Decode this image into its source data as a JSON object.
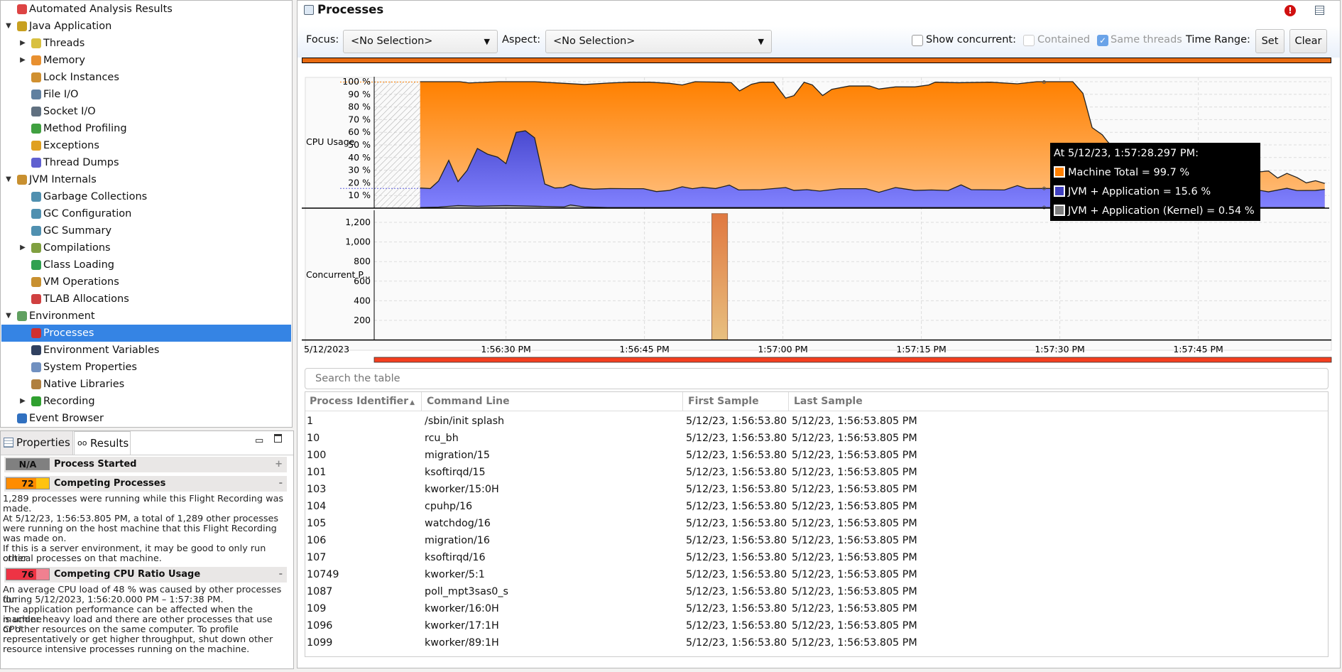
{
  "tree": {
    "items": [
      {
        "label": "Automated Analysis Results",
        "level": 0,
        "icon": "analysis-icon",
        "color": "#d44"
      },
      {
        "label": "Java Application",
        "level": 0,
        "expander": "expanded",
        "icon": "java-app-icon",
        "color": "#c8a020"
      },
      {
        "label": "Threads",
        "level": 1,
        "expander": "collapsed",
        "icon": "threads-icon",
        "color": "#d8c040"
      },
      {
        "label": "Memory",
        "level": 1,
        "expander": "collapsed",
        "icon": "memory-icon",
        "color": "#e89030"
      },
      {
        "label": "Lock Instances",
        "level": 1,
        "icon": "lock-icon",
        "color": "#d09030"
      },
      {
        "label": "File I/O",
        "level": 1,
        "icon": "file-io-icon",
        "color": "#6080a0"
      },
      {
        "label": "Socket I/O",
        "level": 1,
        "icon": "socket-io-icon",
        "color": "#607080"
      },
      {
        "label": "Method Profiling",
        "level": 1,
        "icon": "method-profiling-icon",
        "color": "#40a040"
      },
      {
        "label": "Exceptions",
        "level": 1,
        "icon": "exceptions-icon",
        "color": "#e0a020"
      },
      {
        "label": "Thread Dumps",
        "level": 1,
        "icon": "thread-dumps-icon",
        "color": "#6060d0"
      },
      {
        "label": "JVM Internals",
        "level": 0,
        "expander": "expanded",
        "icon": "jvm-internals-icon",
        "color": "#c89030"
      },
      {
        "label": "Garbage Collections",
        "level": 1,
        "icon": "trash-icon",
        "color": "#5090b0"
      },
      {
        "label": "GC Configuration",
        "level": 1,
        "icon": "gc-config-icon",
        "color": "#5090b0"
      },
      {
        "label": "GC Summary",
        "level": 1,
        "icon": "gc-summary-icon",
        "color": "#5090b0"
      },
      {
        "label": "Compilations",
        "level": 1,
        "expander": "collapsed",
        "icon": "compilations-icon",
        "color": "#80a040"
      },
      {
        "label": "Class Loading",
        "level": 1,
        "icon": "class-loading-icon",
        "color": "#30a050"
      },
      {
        "label": "VM Operations",
        "level": 1,
        "icon": "vm-operations-icon",
        "color": "#c89030"
      },
      {
        "label": "TLAB Allocations",
        "level": 1,
        "icon": "tlab-icon",
        "color": "#d04040"
      },
      {
        "label": "Environment",
        "level": 0,
        "expander": "expanded",
        "icon": "environment-icon",
        "color": "#60a060"
      },
      {
        "label": "Processes",
        "level": 1,
        "icon": "processes-icon",
        "color": "#d03030",
        "selected": true
      },
      {
        "label": "Environment Variables",
        "level": 1,
        "icon": "env-vars-icon",
        "color": "#304060"
      },
      {
        "label": "System Properties",
        "level": 1,
        "icon": "system-properties-icon",
        "color": "#7090c0"
      },
      {
        "label": "Native Libraries",
        "level": 1,
        "icon": "native-libraries-icon",
        "color": "#b08040"
      },
      {
        "label": "Recording",
        "level": 1,
        "expander": "collapsed",
        "icon": "recording-icon",
        "color": "#30a030"
      },
      {
        "label": "Event Browser",
        "level": 0,
        "icon": "event-browser-icon",
        "color": "#3070c0"
      }
    ]
  },
  "bottom_panel": {
    "tabs": [
      {
        "label": "Properties",
        "icon": "properties-icon"
      },
      {
        "label": "Results",
        "icon": "results-icon",
        "active": true
      }
    ],
    "results": [
      {
        "score": "N/A",
        "title": "Process Started",
        "toggle": "+",
        "color": "#808080",
        "color2": "#808080",
        "lines": []
      },
      {
        "score": "72",
        "title": "Competing Processes",
        "toggle": "-",
        "color": "#ff8c00",
        "color2": "#ffc30f",
        "lines": [
          "1,289 processes were running while this Flight Recording was",
          "made.",
          "At 5/12/23, 1:56:53.805 PM, a total of 1,289 other processes",
          "were running on the host machine that this Flight Recording",
          "was made on.",
          "If this is a server environment, it may be good to only run other",
          "critical processes on that machine."
        ]
      },
      {
        "score": "76",
        "title": "Competing CPU Ratio Usage",
        "toggle": "-",
        "color": "#ee3344",
        "color2": "#f08090",
        "lines": [
          "An average CPU load of 48 % was caused by other processes for",
          "during 5/12/2023, 1:56:20.000 PM – 1:57:38 PM.",
          "The application performance can be affected when the machine",
          "is under heavy load and there are other processes that use CPU",
          "or other resources on the same computer. To profile",
          "representatively or get higher throughput, shut down other",
          "resource intensive processes running on the machine."
        ]
      }
    ]
  },
  "page": {
    "title": "Processes",
    "icons": [
      "processes-icon",
      "error-icon",
      "table-menu-icon"
    ]
  },
  "toolbar": {
    "focus_label": "Focus:",
    "focus_value": "<No Selection>",
    "aspect_label": "Aspect:",
    "aspect_value": "<No Selection>",
    "show_concurrent_label": "Show concurrent:",
    "show_concurrent": false,
    "contained_label": "Contained",
    "contained": false,
    "same_threads_label": "Same threads",
    "same_threads": true,
    "time_range_label": "Time Range:",
    "set_label": "Set",
    "clear_label": "Clear",
    "accent": "#e86a10"
  },
  "chart_data": [
    {
      "type": "area",
      "ylabel": "CPU Usage",
      "yticks": [
        "10 %",
        "20 %",
        "30 %",
        "40 %",
        "50 %",
        "60 %",
        "70 %",
        "80 %",
        "90 %",
        "100 %"
      ],
      "ylim": [
        0,
        100
      ],
      "xlim": [
        "1:56:15.8",
        "1:57:59.1"
      ],
      "grid": true,
      "series": [
        {
          "name": "Machine Total",
          "color": "#ff8000",
          "points": [
            [
              "1:56:20.7",
              100
            ],
            [
              "1:56:25.0",
              100
            ],
            [
              "1:56:26.0",
              99
            ],
            [
              "1:56:29.2",
              100
            ],
            [
              "1:56:33.1",
              100
            ],
            [
              "1:56:36.3",
              98.7
            ],
            [
              "1:56:38.5",
              97.8
            ],
            [
              "1:56:41.3",
              99
            ],
            [
              "1:56:43.4",
              99.6
            ],
            [
              "1:56:45.6",
              99.6
            ],
            [
              "1:56:47.7",
              98.7
            ],
            [
              "1:56:49.1",
              97.4
            ],
            [
              "1:56:50.5",
              100
            ],
            [
              "1:56:53.4",
              99.6
            ],
            [
              "1:56:54.4",
              99.3
            ],
            [
              "1:56:55.3",
              92.7
            ],
            [
              "1:56:56.6",
              98
            ],
            [
              "1:56:57.6",
              99.6
            ],
            [
              "1:56:59.0",
              99.6
            ],
            [
              "1:57:00.3",
              87
            ],
            [
              "1:57:01.2",
              89
            ],
            [
              "1:57:02.3",
              99.6
            ],
            [
              "1:57:03.2",
              97.4
            ],
            [
              "1:57:04.3",
              89
            ],
            [
              "1:57:05.3",
              94
            ],
            [
              "1:57:07.2",
              96.6
            ],
            [
              "1:57:09.4",
              96.6
            ],
            [
              "1:57:10.4",
              94.2
            ],
            [
              "1:57:12.2",
              95.9
            ],
            [
              "1:57:14.3",
              95.9
            ],
            [
              "1:57:15.8",
              97.4
            ],
            [
              "1:57:16.5",
              99.6
            ],
            [
              "1:57:19.0",
              99.2
            ],
            [
              "1:57:22.5",
              99.6
            ],
            [
              "1:57:25.4",
              98.3
            ],
            [
              "1:57:27.5",
              100
            ],
            [
              "1:57:31.4",
              100
            ],
            [
              "1:57:32.5",
              90.8
            ],
            [
              "1:57:33.5",
              63.7
            ],
            [
              "1:57:34.6",
              58
            ],
            [
              "1:57:35.2",
              52.4
            ],
            [
              "1:57:36.5",
              42
            ],
            [
              "1:57:38.0",
              34
            ],
            [
              "1:57:40.0",
              31
            ],
            [
              "1:57:43.0",
              30
            ],
            [
              "1:57:46.0",
              29
            ],
            [
              "1:57:49.0",
              31
            ],
            [
              "1:57:51.8",
              28.8
            ],
            [
              "1:57:52.6",
              29.4
            ],
            [
              "1:57:53.6",
              23.8
            ],
            [
              "1:57:54.6",
              27.5
            ],
            [
              "1:57:55.7",
              24.2
            ],
            [
              "1:57:56.7",
              20
            ],
            [
              "1:57:57.7",
              21.7
            ],
            [
              "1:57:58.7",
              19.5
            ]
          ]
        },
        {
          "name": "JVM + Application",
          "color": "#4040c0",
          "points": [
            [
              "1:56:20.7",
              15.9
            ],
            [
              "1:56:21.8",
              15.5
            ],
            [
              "1:56:22.7",
              21.5
            ],
            [
              "1:56:23.8",
              37.8
            ],
            [
              "1:56:24.8",
              21
            ],
            [
              "1:56:25.8",
              30
            ],
            [
              "1:56:26.9",
              47.2
            ],
            [
              "1:56:28.0",
              42.7
            ],
            [
              "1:56:29.1",
              40.3
            ],
            [
              "1:56:30.0",
              35.2
            ],
            [
              "1:56:31.1",
              59.9
            ],
            [
              "1:56:32.1",
              61.2
            ],
            [
              "1:56:33.1",
              55.6
            ],
            [
              "1:56:34.2",
              19.1
            ],
            [
              "1:56:35.3",
              15.9
            ],
            [
              "1:56:36.2",
              16.3
            ],
            [
              "1:56:37.0",
              18.7
            ],
            [
              "1:56:38.1",
              15.9
            ],
            [
              "1:56:39.5",
              15
            ],
            [
              "1:56:41.3",
              15.5
            ],
            [
              "1:56:43.4",
              15.4
            ],
            [
              "1:56:44.9",
              15.4
            ],
            [
              "1:56:46.3",
              13.1
            ],
            [
              "1:56:47.7",
              14
            ],
            [
              "1:56:49.1",
              16.9
            ],
            [
              "1:56:50.2",
              15.4
            ],
            [
              "1:56:51.3",
              16.5
            ],
            [
              "1:56:52.7",
              15.5
            ],
            [
              "1:56:54.2",
              18.2
            ],
            [
              "1:56:55.2",
              14.4
            ],
            [
              "1:56:57.6",
              14.6
            ],
            [
              "1:57:00.3",
              16.3
            ],
            [
              "1:57:01.2",
              14
            ],
            [
              "1:57:02.6",
              14.6
            ],
            [
              "1:57:04.0",
              13.5
            ],
            [
              "1:57:06.2",
              15.4
            ],
            [
              "1:57:09.0",
              15.4
            ],
            [
              "1:57:10.4",
              12.5
            ],
            [
              "1:57:12.2",
              16.3
            ],
            [
              "1:57:14.3",
              14
            ],
            [
              "1:57:16.1",
              14.4
            ],
            [
              "1:57:17.9",
              13.9
            ],
            [
              "1:57:19.3",
              18.4
            ],
            [
              "1:57:20.4",
              14.6
            ],
            [
              "1:57:24.0",
              14.4
            ],
            [
              "1:57:25.4",
              17.8
            ],
            [
              "1:57:26.4",
              15.5
            ],
            [
              "1:57:28.6",
              15.6
            ],
            [
              "1:57:32.0",
              15
            ],
            [
              "1:57:36.0",
              16
            ],
            [
              "1:57:40.0",
              14.5
            ],
            [
              "1:57:44.0",
              15.5
            ],
            [
              "1:57:48.0",
              14.5
            ],
            [
              "1:57:51.8",
              13.9
            ],
            [
              "1:57:52.6",
              12.9
            ],
            [
              "1:57:54.6",
              15.7
            ],
            [
              "1:57:55.7",
              13.9
            ],
            [
              "1:57:57.7",
              14
            ],
            [
              "1:57:58.7",
              14.8
            ]
          ]
        },
        {
          "name": "JVM + Application (Kernel)",
          "color": "#808080",
          "points": [
            [
              "1:56:20.7",
              0.5
            ],
            [
              "1:56:22.7",
              0.8
            ],
            [
              "1:56:24.8",
              2
            ],
            [
              "1:56:26.9",
              1.5
            ],
            [
              "1:56:30.0",
              2
            ],
            [
              "1:56:33.1",
              1.5
            ],
            [
              "1:56:36.3",
              1
            ],
            [
              "1:56:37.0",
              2.5
            ],
            [
              "1:56:38.5",
              1
            ],
            [
              "1:56:41.0",
              0.5
            ],
            [
              "1:57:58.7",
              0.5
            ]
          ]
        }
      ]
    },
    {
      "type": "bar",
      "ylabel": "Concurrent P...",
      "yticks": [
        "200",
        "400",
        "600",
        "800",
        "1,000",
        "1,200"
      ],
      "ylim": [
        0,
        1330
      ],
      "grid": true,
      "bars": [
        {
          "start": "1:56:52.3",
          "end": "1:56:54.0",
          "value": 1289,
          "color": "#e07840"
        }
      ]
    }
  ],
  "x_axis": {
    "date": "5/12/2023",
    "ticks": [
      "1:56:30 PM",
      "1:56:45 PM",
      "1:57:00 PM",
      "1:57:15 PM",
      "1:57:30 PM",
      "1:57:45 PM"
    ]
  },
  "tooltip": {
    "title": "At 5/12/23, 1:57:28.297 PM:",
    "time": "1:57:28.297",
    "rows": [
      {
        "label": "Machine Total = 99.7 %",
        "color": "#ff8000",
        "value": 99.7
      },
      {
        "label": "JVM + Application = 15.6 %",
        "color": "#4040c0",
        "value": 15.6
      },
      {
        "label": "JVM + Application (Kernel) = 0.54 %",
        "color": "#808080",
        "value": 0.54
      }
    ]
  },
  "table": {
    "search_placeholder": "Search the table",
    "columns": [
      "Process Identifier",
      "Command Line",
      "First Sample",
      "Last Sample"
    ],
    "sort_indicator": "▲",
    "rows": [
      [
        "1",
        "/sbin/init splash",
        "5/12/23, 1:56:53.80",
        "5/12/23, 1:56:53.805 PM"
      ],
      [
        "10",
        "rcu_bh",
        "5/12/23, 1:56:53.80",
        "5/12/23, 1:56:53.805 PM"
      ],
      [
        "100",
        "migration/15",
        "5/12/23, 1:56:53.80",
        "5/12/23, 1:56:53.805 PM"
      ],
      [
        "101",
        "ksoftirqd/15",
        "5/12/23, 1:56:53.80",
        "5/12/23, 1:56:53.805 PM"
      ],
      [
        "103",
        "kworker/15:0H",
        "5/12/23, 1:56:53.80",
        "5/12/23, 1:56:53.805 PM"
      ],
      [
        "104",
        "cpuhp/16",
        "5/12/23, 1:56:53.80",
        "5/12/23, 1:56:53.805 PM"
      ],
      [
        "105",
        "watchdog/16",
        "5/12/23, 1:56:53.80",
        "5/12/23, 1:56:53.805 PM"
      ],
      [
        "106",
        "migration/16",
        "5/12/23, 1:56:53.80",
        "5/12/23, 1:56:53.805 PM"
      ],
      [
        "107",
        "ksoftirqd/16",
        "5/12/23, 1:56:53.80",
        "5/12/23, 1:56:53.805 PM"
      ],
      [
        "10749",
        "kworker/5:1",
        "5/12/23, 1:56:53.80",
        "5/12/23, 1:56:53.805 PM"
      ],
      [
        "1087",
        "poll_mpt3sas0_s",
        "5/12/23, 1:56:53.80",
        "5/12/23, 1:56:53.805 PM"
      ],
      [
        "109",
        "kworker/16:0H",
        "5/12/23, 1:56:53.80",
        "5/12/23, 1:56:53.805 PM"
      ],
      [
        "1096",
        "kworker/17:1H",
        "5/12/23, 1:56:53.80",
        "5/12/23, 1:56:53.805 PM"
      ],
      [
        "1099",
        "kworker/89:1H",
        "5/12/23, 1:56:53.80",
        "5/12/23, 1:56:53.805 PM"
      ]
    ]
  }
}
